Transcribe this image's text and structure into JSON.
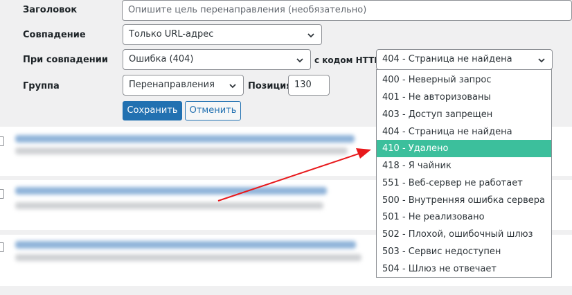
{
  "form": {
    "title_label": "Заголовок",
    "title_placeholder": "Опишите цель перенаправления (необязательно)",
    "match_label": "Совпадение",
    "match_value": "Только URL-адрес",
    "when_matched_label": "При совпадении",
    "when_matched_value": "Ошибка (404)",
    "http_code_label": "с кодом HTTP",
    "http_code_value": "404 - Страница не найдена",
    "group_label": "Группа",
    "group_value": "Перенаправления",
    "position_label": "Позиция",
    "position_value": "130",
    "save_label": "Сохранить",
    "cancel_label": "Отменить"
  },
  "dropdown": {
    "options": [
      "400 - Неверный запрос",
      "401 - Не авторизованы",
      "403 - Доступ запрещен",
      "404 - Страница не найдена",
      "410 - Удалено",
      "418 - Я чайник",
      "551 - Веб-сервер не работает",
      "500 - Внутренняя ошибка сервера",
      "501 - Не реализовано",
      "502 - Плохой, ошибочный шлюз",
      "503 - Сервис недоступен",
      "504 - Шлюз не отвечает"
    ],
    "highlighted_index": 4
  },
  "colors": {
    "primary": "#2271b1",
    "highlight": "#3cbf9c",
    "annotation_arrow": "#e8191c"
  },
  "icons": [
    "chevron-down-icon",
    "annotation-arrow"
  ]
}
